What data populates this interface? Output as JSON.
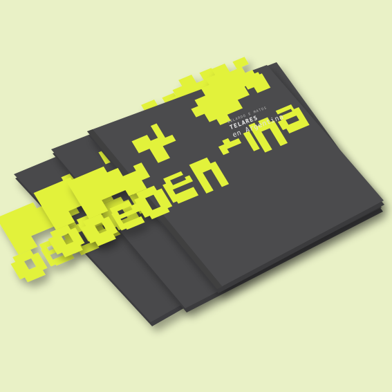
{
  "scene": {
    "subject": "three stacked booklets",
    "colors": {
      "background": "#e9f1c6",
      "cover": "#4a4a4c",
      "cover_dark": "#3f3f41",
      "accent": "#e2f23a"
    }
  },
  "booklet": {
    "count": 3,
    "cover_text": {
      "authors": "BELARDO E MATOS",
      "title": "TELARES",
      "subtitle": "en Argentina"
    }
  }
}
